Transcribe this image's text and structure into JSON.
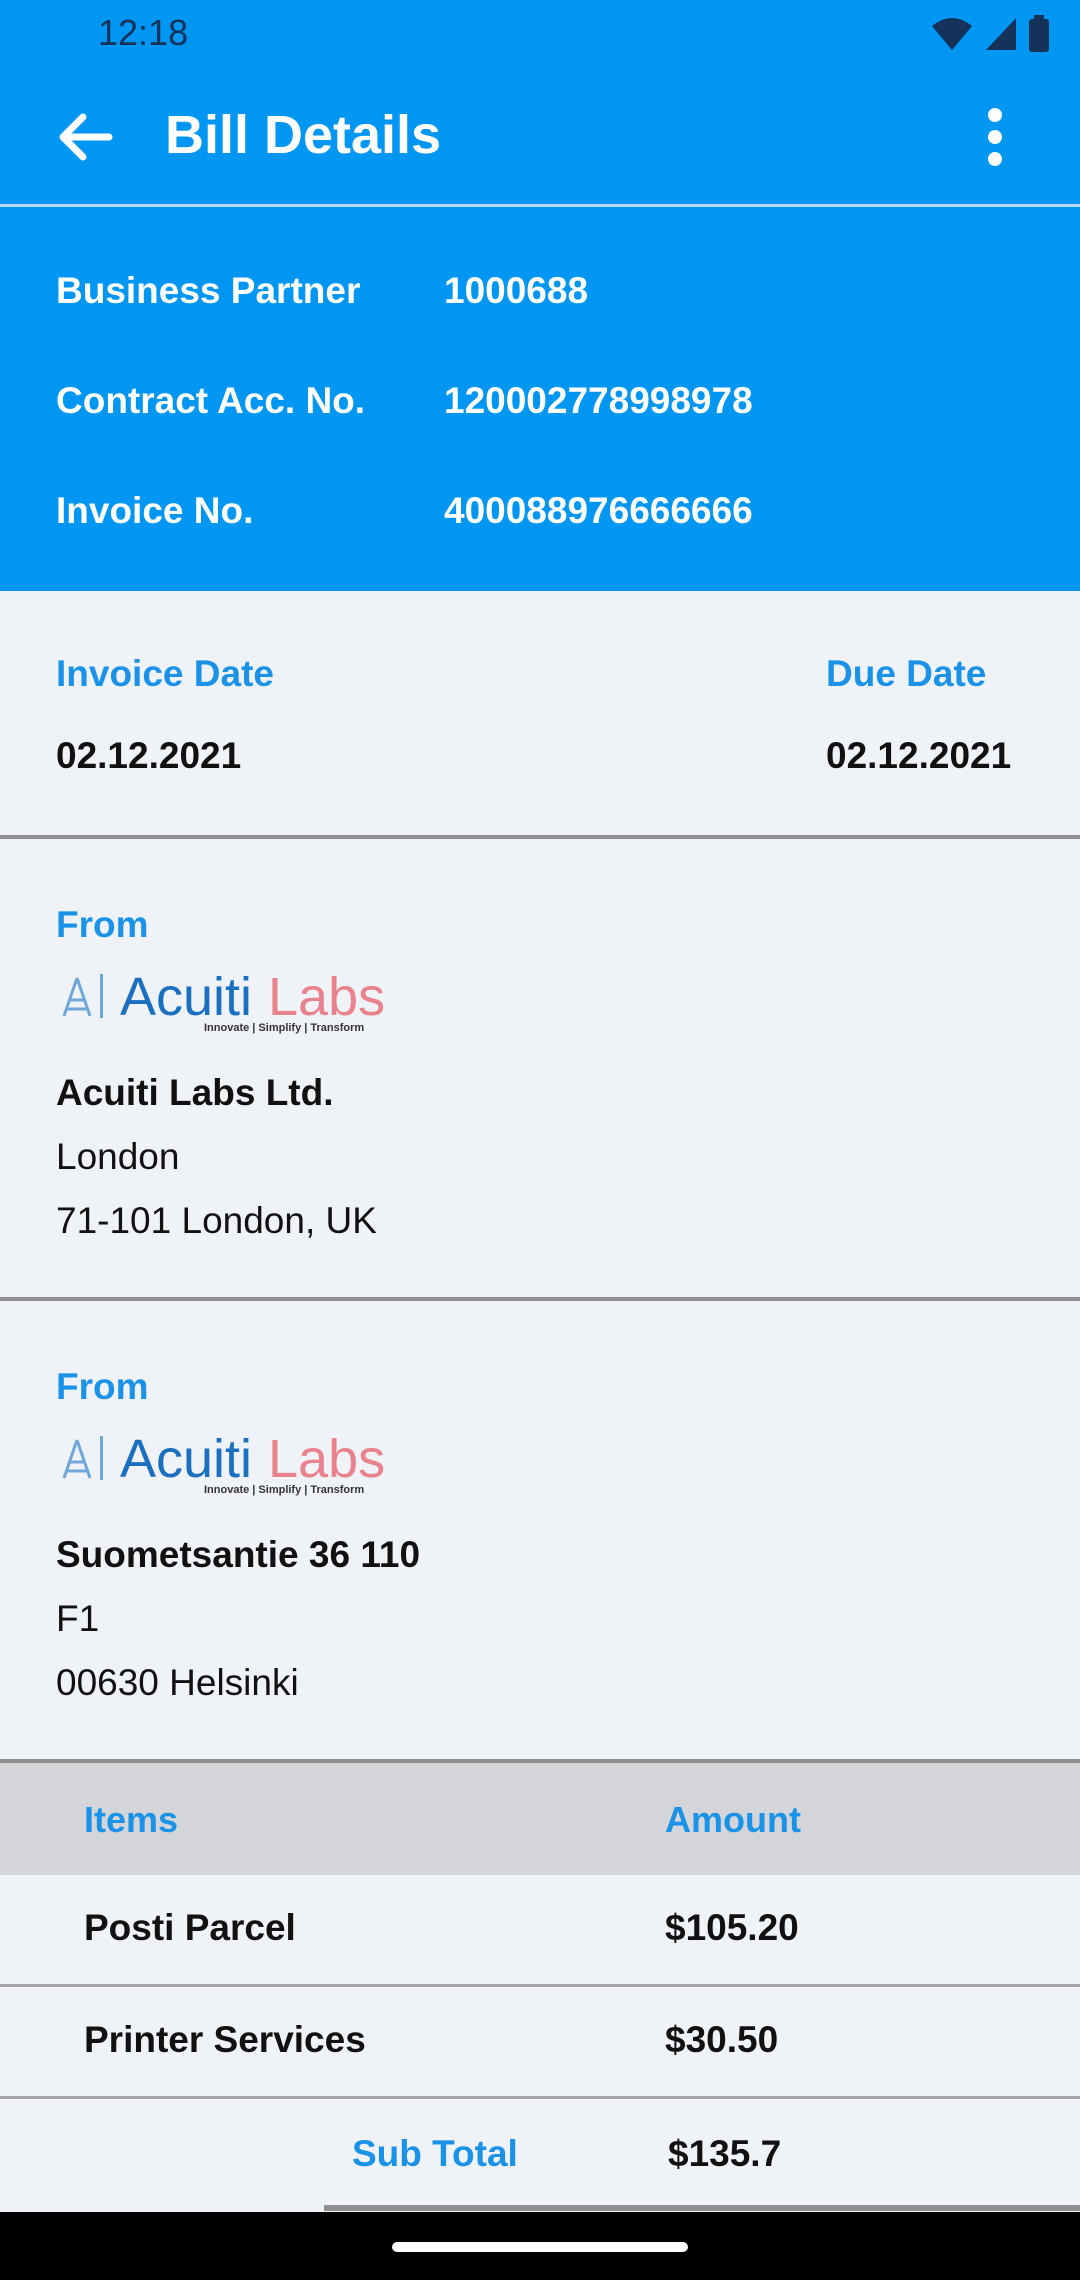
{
  "status_bar": {
    "time": "12:18"
  },
  "app_bar": {
    "title": "Bill Details"
  },
  "summary": {
    "business_partner_label": "Business Partner",
    "business_partner_value": "1000688",
    "contract_label": "Contract Acc. No.",
    "contract_value": "120002778998978",
    "invoice_label": "Invoice No.",
    "invoice_value": "400088976666666"
  },
  "dates": {
    "invoice_date_label": "Invoice Date",
    "invoice_date_value": "02.12.2021",
    "due_date_label": "Due Date",
    "due_date_value": "02.12.2021"
  },
  "from_1": {
    "label": "From",
    "logo_text_a": "Acuiti",
    "logo_text_b": "Labs",
    "logo_tagline": "Innovate | Simplify | Transform",
    "line1": "Acuiti Labs Ltd.",
    "line2": "London",
    "line3": "71-101 London, UK"
  },
  "from_2": {
    "label": "From",
    "logo_text_a": "Acuiti",
    "logo_text_b": "Labs",
    "logo_tagline": "Innovate | Simplify | Transform",
    "line1": "Suometsantie 36 110",
    "line2": "F1",
    "line3": "00630 Helsinki"
  },
  "items": {
    "header_items": "Items",
    "header_amount": "Amount",
    "rows": [
      {
        "name": "Posti Parcel",
        "amount": "$105.20"
      },
      {
        "name": "Printer Services",
        "amount": "$30.50"
      }
    ],
    "subtotal_label": "Sub Total",
    "subtotal_value": "$135.7"
  },
  "colors": {
    "primary": "#0096f2",
    "accent_text": "#1a92e8",
    "background": "#eff2f7"
  }
}
